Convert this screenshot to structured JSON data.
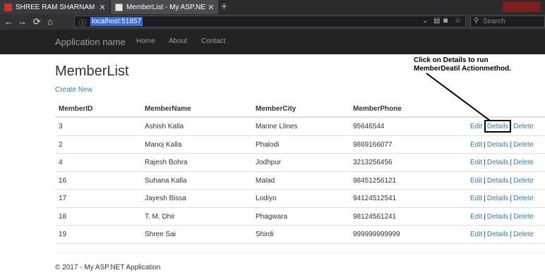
{
  "browser": {
    "tabs": [
      {
        "label": "SHREE RAM SHARNAM - Inter",
        "active": false
      },
      {
        "label": "MemberList - My ASP.NET App",
        "active": true
      }
    ],
    "url": "localhost:51857",
    "search_placeholder": "Search"
  },
  "site": {
    "brand": "Application name",
    "nav": [
      "Home",
      "About",
      "Contact"
    ]
  },
  "page": {
    "title": "MemberList",
    "create_new": "Create New",
    "columns": [
      "MemberID",
      "MemberName",
      "MemberCity",
      "MemberPhone"
    ],
    "rows": [
      {
        "id": "3",
        "name": "Ashish Kalla",
        "city": "Marine Llines",
        "phone": "95646544"
      },
      {
        "id": "2",
        "name": "Manoj Kalla",
        "city": "Phalodi",
        "phone": "9869166077"
      },
      {
        "id": "4",
        "name": "Rajesh Bohra",
        "city": "Jodhpur",
        "phone": "3213256456"
      },
      {
        "id": "16",
        "name": "Suhana Kalla",
        "city": "Malad",
        "phone": "98451256121"
      },
      {
        "id": "17",
        "name": "Jayesh Bissa",
        "city": "Lodiyo",
        "phone": "94124512541"
      },
      {
        "id": "18",
        "name": "T. M. Dhir",
        "city": "Phagwara",
        "phone": "98124561241"
      },
      {
        "id": "19",
        "name": "Shree Sai",
        "city": "Shirdi",
        "phone": "999999999999"
      }
    ],
    "actions": {
      "edit": "Edit",
      "details": "Details",
      "delete": "Delete",
      "separator": "|"
    }
  },
  "annotation": {
    "line1": "Click on Details to run",
    "line2": "MemberDeatil Actionmethod."
  },
  "footer": "© 2017 - My ASP.NET Application"
}
